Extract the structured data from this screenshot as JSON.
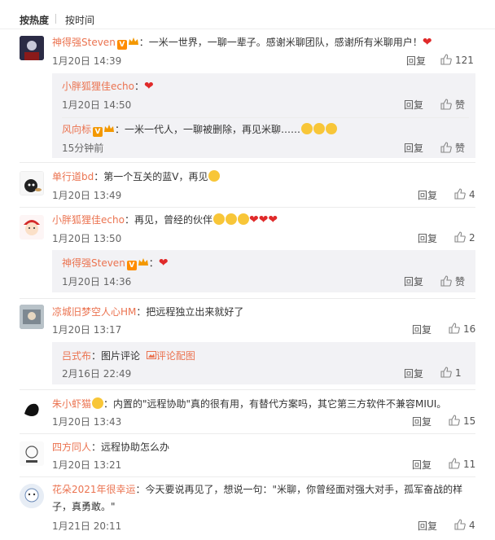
{
  "tabs": {
    "hot": "按热度",
    "time": "按时间"
  },
  "actions": {
    "reply": "回复",
    "praise": "赞"
  },
  "comments": [
    {
      "user": "神得强Steven",
      "text": "：一米一世界，一聊一辈子。感谢米聊团队，感谢所有米聊用户！",
      "time": "1月20日 14:39",
      "likes": "121"
    },
    {
      "user": "小胖狐狸佳echo",
      "text": "：",
      "time": "1月20日 14:50",
      "likes": "赞"
    },
    {
      "user": "风向标",
      "text": "：一米一代人，一聊被删除，再见米聊……",
      "time": "15分钟前",
      "likes": "赞"
    },
    {
      "user": "单行道bd",
      "text": "：第一个互关的蓝V，再见",
      "time": "1月20日 13:49",
      "likes": "4"
    },
    {
      "user": "小胖狐狸佳echo",
      "text": "：再见，曾经的伙伴",
      "time": "1月20日 13:50",
      "likes": "2"
    },
    {
      "user": "神得强Steven",
      "text": "：",
      "time": "1月20日 14:36",
      "likes": "赞"
    },
    {
      "user": "凉城旧梦空人心HM",
      "text": "：把远程独立出来就好了",
      "time": "1月20日 13:17",
      "likes": "16"
    },
    {
      "user": "吕式布",
      "text": "：图片评论",
      "link": "评论配图",
      "time": "2月16日 22:49",
      "likes": "1"
    },
    {
      "user": "朱小虾猫",
      "text": "：内置的\"远程协助\"真的很有用，有替代方案吗，其它第三方软件不兼容MIUI。",
      "time": "1月20日 13:43",
      "likes": "15"
    },
    {
      "user": "四方同人",
      "text": "：远程协助怎么办",
      "time": "1月20日 13:21",
      "likes": "11"
    },
    {
      "user": "花朵2021年很幸运",
      "text": "：今天要说再见了，想说一句：\"米聊，你曾经面对强大对手，孤军奋战的样",
      "text2": "子，真勇敢。\"",
      "time": "1月21日 20:11",
      "likes": "4"
    }
  ],
  "colors": {
    "username": "#eb7350",
    "heart": "#e02a2a",
    "reply_bg": "#f2f2f5"
  }
}
